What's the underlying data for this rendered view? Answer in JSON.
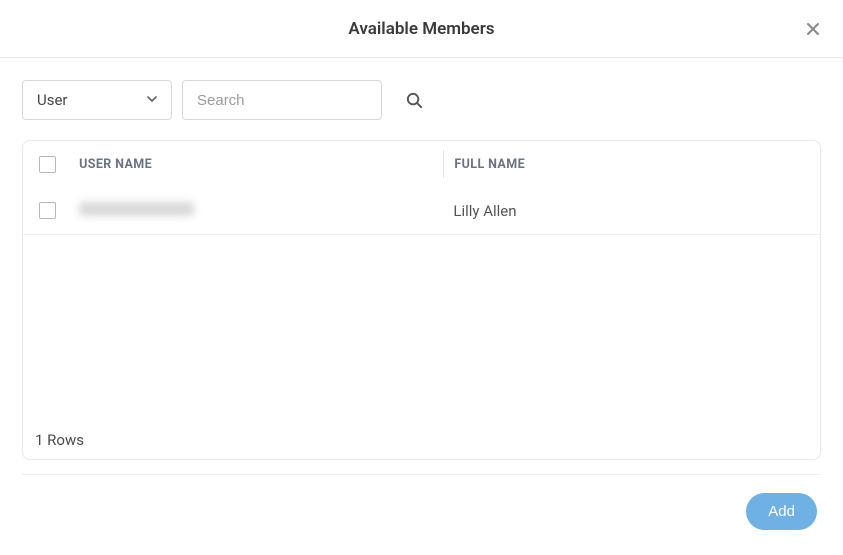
{
  "dialog": {
    "title": "Available Members"
  },
  "filter": {
    "select_value": "User",
    "search_placeholder": "Search"
  },
  "table": {
    "headers": {
      "username": "USER NAME",
      "fullname": "FULL NAME"
    },
    "rows": [
      {
        "username": "",
        "fullname": "Lilly Allen"
      }
    ],
    "footer": "1 Rows"
  },
  "actions": {
    "add": "Add"
  }
}
